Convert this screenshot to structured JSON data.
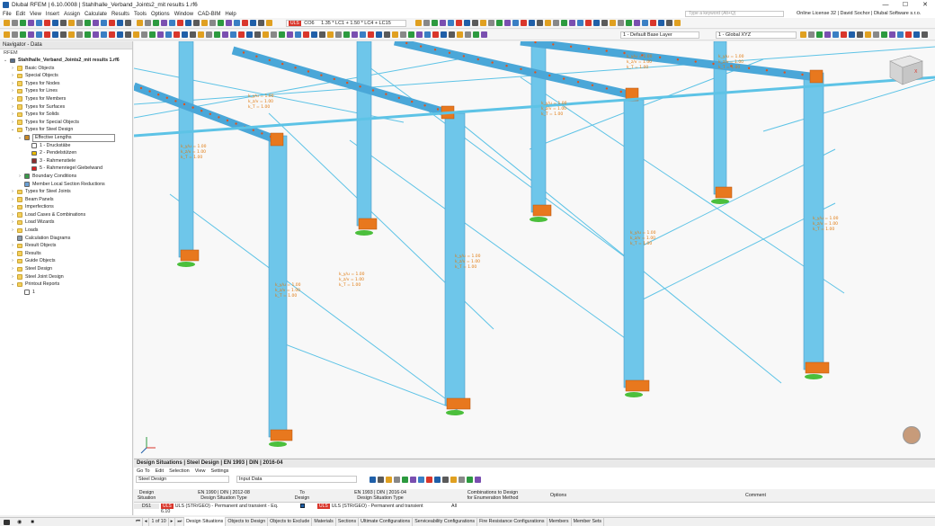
{
  "window": {
    "title": "Dlubal RFEM | 6.10.0008 | Stahlhalle_Verband_Joints2_mit results 1.rf6",
    "controls": [
      "—",
      "☐",
      "✕"
    ]
  },
  "menu": [
    "File",
    "Edit",
    "View",
    "Insert",
    "Assign",
    "Calculate",
    "Results",
    "Tools",
    "Options",
    "Window",
    "CAD-BIM",
    "Help"
  ],
  "search": {
    "placeholder": "Type a keyword (Alt+Q)"
  },
  "license": "Online License 32 | David Sochor | Dlubal Software s.r.o.",
  "toolbar": {
    "uls_badge": "ULS",
    "combo_id": "CO6",
    "combo_formula": "1.35 * LC1 + 1.50 * LC4 + LC15",
    "layer": "1 - Default Base Layer",
    "coord_system": "1 - Global XYZ"
  },
  "navigator": {
    "title": "Navigator - Data",
    "subtitle": "RFEM",
    "items": [
      {
        "label": "Stahlhalle_Verband_Joints2_mit results 1.rf6",
        "level": 0,
        "toggle": "⌄",
        "icon": "model",
        "bold": true
      },
      {
        "label": "Basic Objects",
        "level": 1,
        "toggle": "›",
        "icon": "folder"
      },
      {
        "label": "Special Objects",
        "level": 1,
        "toggle": "›",
        "icon": "folder"
      },
      {
        "label": "Types for Nodes",
        "level": 1,
        "toggle": "›",
        "icon": "folder"
      },
      {
        "label": "Types for Lines",
        "level": 1,
        "toggle": "›",
        "icon": "folder"
      },
      {
        "label": "Types for Members",
        "level": 1,
        "toggle": "›",
        "icon": "folder"
      },
      {
        "label": "Types for Surfaces",
        "level": 1,
        "toggle": "›",
        "icon": "folder"
      },
      {
        "label": "Types for Solids",
        "level": 1,
        "toggle": "›",
        "icon": "folder"
      },
      {
        "label": "Types for Special Objects",
        "level": 1,
        "toggle": "›",
        "icon": "folder"
      },
      {
        "label": "Types for Steel Design",
        "level": 1,
        "toggle": "⌄",
        "icon": "folder"
      },
      {
        "label": "Effective Lengths",
        "level": 2,
        "toggle": "⌄",
        "icon": "effective-lengths",
        "selected": true
      },
      {
        "label": "1 - Druckstäbe",
        "level": 3,
        "toggle": "",
        "icon": "square-white"
      },
      {
        "label": "2 - Pendelstützen",
        "level": 3,
        "toggle": "",
        "icon": "square-yellow"
      },
      {
        "label": "3 - Rahmenstiele",
        "level": 3,
        "toggle": "",
        "icon": "square-brown"
      },
      {
        "label": "5 - Rahmenriegel Giebelwand",
        "level": 3,
        "toggle": "",
        "icon": "square-red"
      },
      {
        "label": "Boundary Conditions",
        "level": 2,
        "toggle": "›",
        "icon": "boundary"
      },
      {
        "label": "Member Local Section Reductions",
        "level": 2,
        "toggle": "",
        "icon": "reduction"
      },
      {
        "label": "Types for Steel Joints",
        "level": 1,
        "toggle": "›",
        "icon": "folder"
      },
      {
        "label": "Beam Panels",
        "level": 1,
        "toggle": "›",
        "icon": "folder"
      },
      {
        "label": "Imperfections",
        "level": 1,
        "toggle": "›",
        "icon": "folder"
      },
      {
        "label": "Load Cases & Combinations",
        "level": 1,
        "toggle": "›",
        "icon": "folder"
      },
      {
        "label": "Load Wizards",
        "level": 1,
        "toggle": "›",
        "icon": "folder"
      },
      {
        "label": "Loads",
        "level": 1,
        "toggle": "›",
        "icon": "folder"
      },
      {
        "label": "Calculation Diagrams",
        "level": 1,
        "toggle": "",
        "icon": "diagram"
      },
      {
        "label": "Result Objects",
        "level": 1,
        "toggle": "›",
        "icon": "folder"
      },
      {
        "label": "Results",
        "level": 1,
        "toggle": "›",
        "icon": "folder"
      },
      {
        "label": "Guide Objects",
        "level": 1,
        "toggle": "›",
        "icon": "folder"
      },
      {
        "label": "Steel Design",
        "level": 1,
        "toggle": "›",
        "icon": "folder"
      },
      {
        "label": "Steel Joint Design",
        "level": 1,
        "toggle": "›",
        "icon": "folder"
      },
      {
        "label": "Printout Reports",
        "level": 1,
        "toggle": "⌄",
        "icon": "folder"
      },
      {
        "label": "1",
        "level": 2,
        "toggle": "",
        "icon": "report"
      }
    ]
  },
  "viewport": {
    "label_lines": [
      "k_y/u = 1.00",
      "k_z/v = 1.00",
      "k_T = 1.00"
    ]
  },
  "panel": {
    "title": "Design Situations | Steel Design | EN 1993 | DIN | 2016-04",
    "menu": [
      "Go To",
      "Edit",
      "Selection",
      "View",
      "Settings"
    ],
    "module_combo": "Steel Design",
    "data_combo": "Input Data",
    "table": {
      "headers": {
        "situation": [
          "Design",
          "Situation"
        ],
        "type_en1990": [
          "EN 1990 | DIN | 2012-08",
          "Design Situation Type"
        ],
        "to_design": [
          "To",
          "Design"
        ],
        "type_en1993": [
          "EN 1993 | DIN | 2016-04",
          "Design Situation Type"
        ],
        "combinations": [
          "Combinations to Design",
          "for Enumeration Method"
        ],
        "options": "Options",
        "comment": "Comment"
      },
      "rows": [
        {
          "id": "DS1",
          "badge": "ULS",
          "type_en1990": "ULS (STR/GEO) - Permanent and transient - Eq. 6.10",
          "type_en1993": "ULS (STR/GEO) - Permanent and transient",
          "combinations": "All",
          "options": "",
          "comment": ""
        }
      ]
    }
  },
  "statusbar": {
    "pagination": "1 of 10",
    "tabs": [
      "Design Situations",
      "Objects to Design",
      "Objects to Exclude",
      "Materials",
      "Sections",
      "Ultimate Configurations",
      "Serviceability Configurations",
      "Fire Resistance Configurations",
      "Members",
      "Member Sets"
    ],
    "active_tab": "Design Situations"
  },
  "colors": {
    "column": "#6ec6ea",
    "beam": "#4aa7d8",
    "bracing": "#5dc3e6",
    "joint": "#e8781e",
    "support": "#4bbf3c",
    "hinge_dot": "#e2541c",
    "label": "#e07a10"
  }
}
